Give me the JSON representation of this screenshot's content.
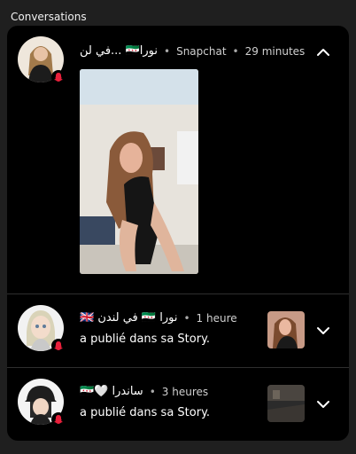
{
  "section": {
    "title": "Conversations"
  },
  "conversations": [
    {
      "name": "في لن... 🇸🇾نورا",
      "source": "Snapchat",
      "time": "29 minutes",
      "expanded": true
    },
    {
      "name": "🇬🇧 في لندن 🇸🇾 نورا",
      "time": "1 heure",
      "subtitle": "a publié dans sa Story."
    },
    {
      "name": "🇸🇾🤍 ساندرا",
      "time": "3 heures",
      "subtitle": "a publié dans sa Story."
    }
  ],
  "icons": {
    "expanded": "chevron-up-icon",
    "collapsed": "chevron-down-icon",
    "badge": "snapchat-ghost-icon"
  },
  "colors": {
    "panel": "#000000",
    "background": "#1f1f1f",
    "badge": "#e8203b"
  }
}
